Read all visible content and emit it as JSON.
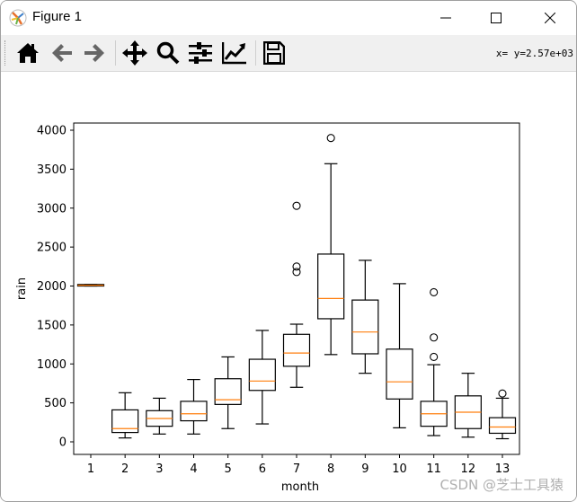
{
  "window": {
    "title": "Figure 1",
    "controls": {
      "minimize": "minimize",
      "maximize": "maximize",
      "close": "close"
    }
  },
  "toolbar": {
    "buttons": [
      {
        "name": "home",
        "icon": "home-icon"
      },
      {
        "name": "back",
        "icon": "arrow-left-icon"
      },
      {
        "name": "forward",
        "icon": "arrow-right-icon"
      },
      {
        "name": "pan",
        "icon": "move-icon"
      },
      {
        "name": "zoom",
        "icon": "magnifier-icon"
      },
      {
        "name": "configure-subplots",
        "icon": "sliders-icon"
      },
      {
        "name": "edit-axis",
        "icon": "line-chart-icon"
      },
      {
        "name": "save",
        "icon": "floppy-disk-icon"
      }
    ],
    "coords": "x= y=2.57e+03"
  },
  "watermark": "CSDN @芝士工具猿",
  "chart_data": {
    "type": "boxplot",
    "title": "",
    "xlabel": "month",
    "ylabel": "rain",
    "ylim": [
      -150,
      4100
    ],
    "yticks": [
      0,
      500,
      1000,
      1500,
      2000,
      2500,
      3000,
      3500,
      4000
    ],
    "categories": [
      "1",
      "2",
      "3",
      "4",
      "5",
      "6",
      "7",
      "8",
      "9",
      "10",
      "11",
      "12",
      "13"
    ],
    "grid": false,
    "colors": {
      "box": "#000000",
      "median": "#ff7f0e"
    },
    "boxes": [
      {
        "label": "1",
        "whislo": 2000,
        "q1": 2000,
        "med": 2010,
        "q3": 2020,
        "whishi": 2020,
        "fliers": []
      },
      {
        "label": "2",
        "whislo": 50,
        "q1": 120,
        "med": 170,
        "q3": 410,
        "whishi": 630,
        "fliers": []
      },
      {
        "label": "3",
        "whislo": 100,
        "q1": 200,
        "med": 300,
        "q3": 400,
        "whishi": 560,
        "fliers": []
      },
      {
        "label": "4",
        "whislo": 100,
        "q1": 270,
        "med": 360,
        "q3": 520,
        "whishi": 800,
        "fliers": []
      },
      {
        "label": "5",
        "whislo": 170,
        "q1": 480,
        "med": 540,
        "q3": 810,
        "whishi": 1090,
        "fliers": []
      },
      {
        "label": "6",
        "whislo": 230,
        "q1": 660,
        "med": 780,
        "q3": 1060,
        "whishi": 1430,
        "fliers": []
      },
      {
        "label": "7",
        "whislo": 700,
        "q1": 970,
        "med": 1140,
        "q3": 1380,
        "whishi": 1510,
        "fliers": [
          2180,
          2250,
          3030
        ]
      },
      {
        "label": "8",
        "whislo": 1120,
        "q1": 1580,
        "med": 1840,
        "q3": 2410,
        "whishi": 3570,
        "fliers": [
          3900
        ]
      },
      {
        "label": "9",
        "whislo": 880,
        "q1": 1130,
        "med": 1410,
        "q3": 1820,
        "whishi": 2330,
        "fliers": []
      },
      {
        "label": "10",
        "whislo": 180,
        "q1": 550,
        "med": 770,
        "q3": 1190,
        "whishi": 2030,
        "fliers": []
      },
      {
        "label": "11",
        "whislo": 80,
        "q1": 200,
        "med": 360,
        "q3": 520,
        "whishi": 990,
        "fliers": [
          1090,
          1340,
          1920
        ]
      },
      {
        "label": "12",
        "whislo": 60,
        "q1": 170,
        "med": 380,
        "q3": 590,
        "whishi": 880,
        "fliers": []
      },
      {
        "label": "13",
        "whislo": 40,
        "q1": 110,
        "med": 190,
        "q3": 310,
        "whishi": 560,
        "fliers": [
          620
        ]
      }
    ]
  }
}
